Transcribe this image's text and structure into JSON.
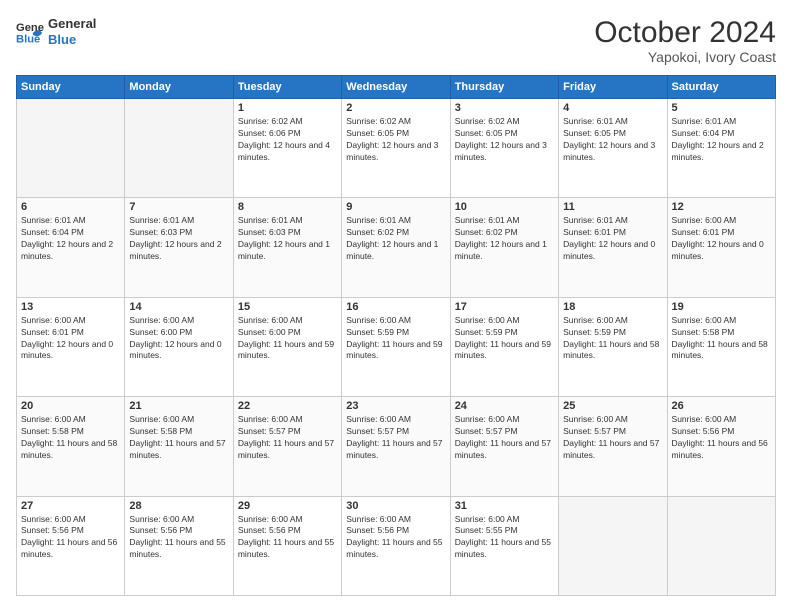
{
  "logo": {
    "line1": "General",
    "line2": "Blue"
  },
  "title": "October 2024",
  "location": "Yapokoi, Ivory Coast",
  "weekdays": [
    "Sunday",
    "Monday",
    "Tuesday",
    "Wednesday",
    "Thursday",
    "Friday",
    "Saturday"
  ],
  "weeks": [
    [
      null,
      null,
      {
        "day": "1",
        "sunrise": "Sunrise: 6:02 AM",
        "sunset": "Sunset: 6:06 PM",
        "daylight": "Daylight: 12 hours and 4 minutes."
      },
      {
        "day": "2",
        "sunrise": "Sunrise: 6:02 AM",
        "sunset": "Sunset: 6:05 PM",
        "daylight": "Daylight: 12 hours and 3 minutes."
      },
      {
        "day": "3",
        "sunrise": "Sunrise: 6:02 AM",
        "sunset": "Sunset: 6:05 PM",
        "daylight": "Daylight: 12 hours and 3 minutes."
      },
      {
        "day": "4",
        "sunrise": "Sunrise: 6:01 AM",
        "sunset": "Sunset: 6:05 PM",
        "daylight": "Daylight: 12 hours and 3 minutes."
      },
      {
        "day": "5",
        "sunrise": "Sunrise: 6:01 AM",
        "sunset": "Sunset: 6:04 PM",
        "daylight": "Daylight: 12 hours and 2 minutes."
      }
    ],
    [
      {
        "day": "6",
        "sunrise": "Sunrise: 6:01 AM",
        "sunset": "Sunset: 6:04 PM",
        "daylight": "Daylight: 12 hours and 2 minutes."
      },
      {
        "day": "7",
        "sunrise": "Sunrise: 6:01 AM",
        "sunset": "Sunset: 6:03 PM",
        "daylight": "Daylight: 12 hours and 2 minutes."
      },
      {
        "day": "8",
        "sunrise": "Sunrise: 6:01 AM",
        "sunset": "Sunset: 6:03 PM",
        "daylight": "Daylight: 12 hours and 1 minute."
      },
      {
        "day": "9",
        "sunrise": "Sunrise: 6:01 AM",
        "sunset": "Sunset: 6:02 PM",
        "daylight": "Daylight: 12 hours and 1 minute."
      },
      {
        "day": "10",
        "sunrise": "Sunrise: 6:01 AM",
        "sunset": "Sunset: 6:02 PM",
        "daylight": "Daylight: 12 hours and 1 minute."
      },
      {
        "day": "11",
        "sunrise": "Sunrise: 6:01 AM",
        "sunset": "Sunset: 6:01 PM",
        "daylight": "Daylight: 12 hours and 0 minutes."
      },
      {
        "day": "12",
        "sunrise": "Sunrise: 6:00 AM",
        "sunset": "Sunset: 6:01 PM",
        "daylight": "Daylight: 12 hours and 0 minutes."
      }
    ],
    [
      {
        "day": "13",
        "sunrise": "Sunrise: 6:00 AM",
        "sunset": "Sunset: 6:01 PM",
        "daylight": "Daylight: 12 hours and 0 minutes."
      },
      {
        "day": "14",
        "sunrise": "Sunrise: 6:00 AM",
        "sunset": "Sunset: 6:00 PM",
        "daylight": "Daylight: 12 hours and 0 minutes."
      },
      {
        "day": "15",
        "sunrise": "Sunrise: 6:00 AM",
        "sunset": "Sunset: 6:00 PM",
        "daylight": "Daylight: 11 hours and 59 minutes."
      },
      {
        "day": "16",
        "sunrise": "Sunrise: 6:00 AM",
        "sunset": "Sunset: 5:59 PM",
        "daylight": "Daylight: 11 hours and 59 minutes."
      },
      {
        "day": "17",
        "sunrise": "Sunrise: 6:00 AM",
        "sunset": "Sunset: 5:59 PM",
        "daylight": "Daylight: 11 hours and 59 minutes."
      },
      {
        "day": "18",
        "sunrise": "Sunrise: 6:00 AM",
        "sunset": "Sunset: 5:59 PM",
        "daylight": "Daylight: 11 hours and 58 minutes."
      },
      {
        "day": "19",
        "sunrise": "Sunrise: 6:00 AM",
        "sunset": "Sunset: 5:58 PM",
        "daylight": "Daylight: 11 hours and 58 minutes."
      }
    ],
    [
      {
        "day": "20",
        "sunrise": "Sunrise: 6:00 AM",
        "sunset": "Sunset: 5:58 PM",
        "daylight": "Daylight: 11 hours and 58 minutes."
      },
      {
        "day": "21",
        "sunrise": "Sunrise: 6:00 AM",
        "sunset": "Sunset: 5:58 PM",
        "daylight": "Daylight: 11 hours and 57 minutes."
      },
      {
        "day": "22",
        "sunrise": "Sunrise: 6:00 AM",
        "sunset": "Sunset: 5:57 PM",
        "daylight": "Daylight: 11 hours and 57 minutes."
      },
      {
        "day": "23",
        "sunrise": "Sunrise: 6:00 AM",
        "sunset": "Sunset: 5:57 PM",
        "daylight": "Daylight: 11 hours and 57 minutes."
      },
      {
        "day": "24",
        "sunrise": "Sunrise: 6:00 AM",
        "sunset": "Sunset: 5:57 PM",
        "daylight": "Daylight: 11 hours and 57 minutes."
      },
      {
        "day": "25",
        "sunrise": "Sunrise: 6:00 AM",
        "sunset": "Sunset: 5:57 PM",
        "daylight": "Daylight: 11 hours and 57 minutes."
      },
      {
        "day": "26",
        "sunrise": "Sunrise: 6:00 AM",
        "sunset": "Sunset: 5:56 PM",
        "daylight": "Daylight: 11 hours and 56 minutes."
      }
    ],
    [
      {
        "day": "27",
        "sunrise": "Sunrise: 6:00 AM",
        "sunset": "Sunset: 5:56 PM",
        "daylight": "Daylight: 11 hours and 56 minutes."
      },
      {
        "day": "28",
        "sunrise": "Sunrise: 6:00 AM",
        "sunset": "Sunset: 5:56 PM",
        "daylight": "Daylight: 11 hours and 55 minutes."
      },
      {
        "day": "29",
        "sunrise": "Sunrise: 6:00 AM",
        "sunset": "Sunset: 5:56 PM",
        "daylight": "Daylight: 11 hours and 55 minutes."
      },
      {
        "day": "30",
        "sunrise": "Sunrise: 6:00 AM",
        "sunset": "Sunset: 5:56 PM",
        "daylight": "Daylight: 11 hours and 55 minutes."
      },
      {
        "day": "31",
        "sunrise": "Sunrise: 6:00 AM",
        "sunset": "Sunset: 5:55 PM",
        "daylight": "Daylight: 11 hours and 55 minutes."
      },
      null,
      null
    ]
  ]
}
